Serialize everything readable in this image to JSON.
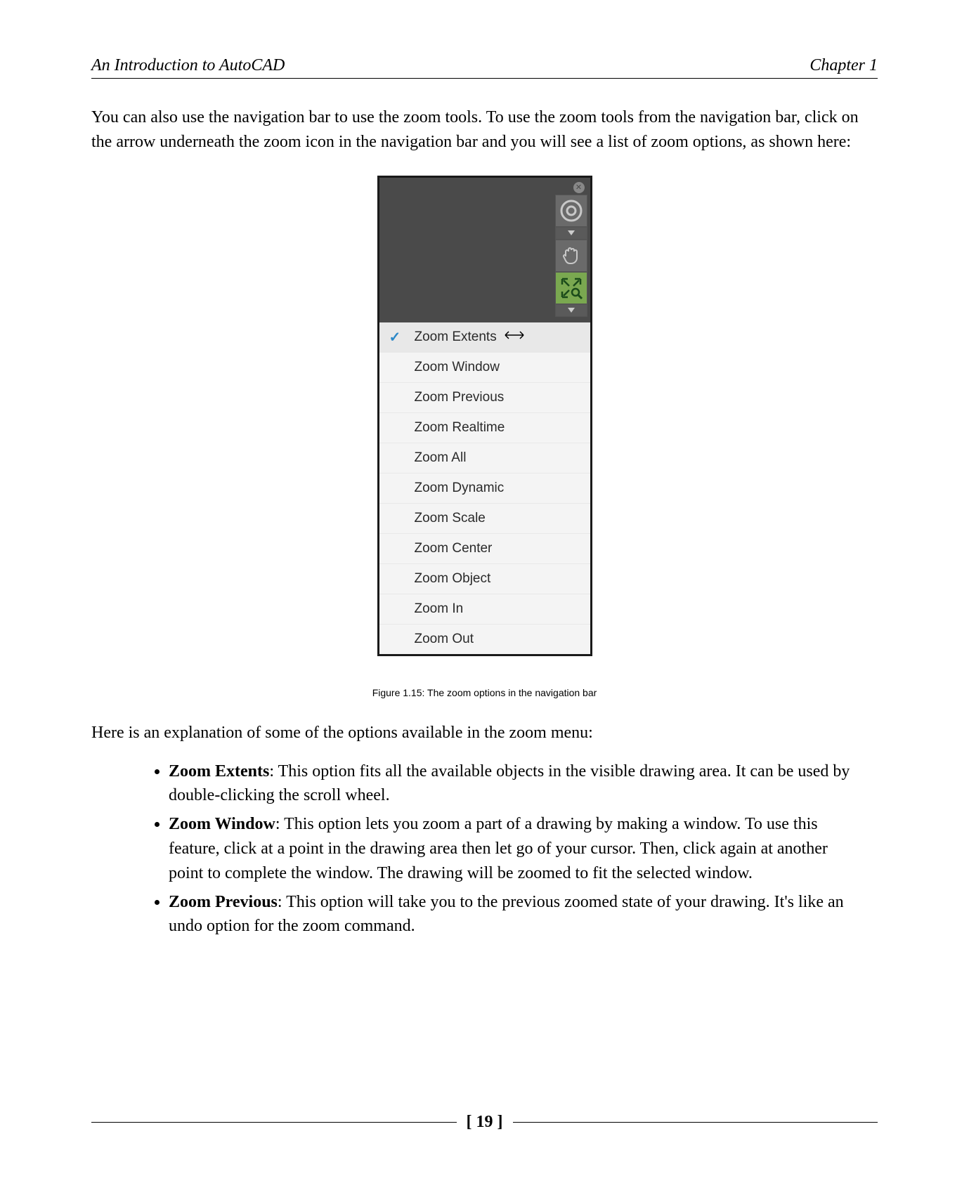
{
  "header": {
    "book_title": "An Introduction to AutoCAD",
    "chapter_label": "Chapter 1"
  },
  "intro_paragraph": "You can also use the navigation bar to use the zoom tools. To use the zoom tools from the navigation bar, click on the arrow underneath the zoom icon in the navigation bar and you will see a list of zoom options, as shown here:",
  "navbar_icons": {
    "close": "close-icon",
    "wheel": "steering-wheel-icon",
    "pan": "pan-hand-icon",
    "zoom": "zoom-extents-icon"
  },
  "menu_items": [
    {
      "label": "Zoom Extents",
      "selected": true
    },
    {
      "label": "Zoom Window",
      "selected": false
    },
    {
      "label": "Zoom Previous",
      "selected": false
    },
    {
      "label": "Zoom Realtime",
      "selected": false
    },
    {
      "label": "Zoom All",
      "selected": false
    },
    {
      "label": "Zoom Dynamic",
      "selected": false
    },
    {
      "label": "Zoom Scale",
      "selected": false
    },
    {
      "label": "Zoom Center",
      "selected": false
    },
    {
      "label": "Zoom Object",
      "selected": false
    },
    {
      "label": "Zoom In",
      "selected": false
    },
    {
      "label": "Zoom Out",
      "selected": false
    }
  ],
  "figure_caption": "Figure 1.15: The zoom options in the navigation bar",
  "explain_intro": "Here is an explanation of some of the options available in the zoom menu:",
  "explanations": [
    {
      "term": "Zoom Extents",
      "desc": ": This option fits all the available objects in the visible drawing area. It can be used by double-clicking the scroll wheel."
    },
    {
      "term": "Zoom Window",
      "desc": ": This option lets you zoom a part of a drawing by making a window. To use this feature, click at a point in the drawing area then let go of your cursor. Then, click again at another point to complete the window. The drawing will be zoomed to fit the selected window."
    },
    {
      "term": "Zoom Previous",
      "desc": ": This option will take you to the previous zoomed state of your drawing. It's like an undo option for the zoom command."
    }
  ],
  "page_number": "[ 19 ]"
}
